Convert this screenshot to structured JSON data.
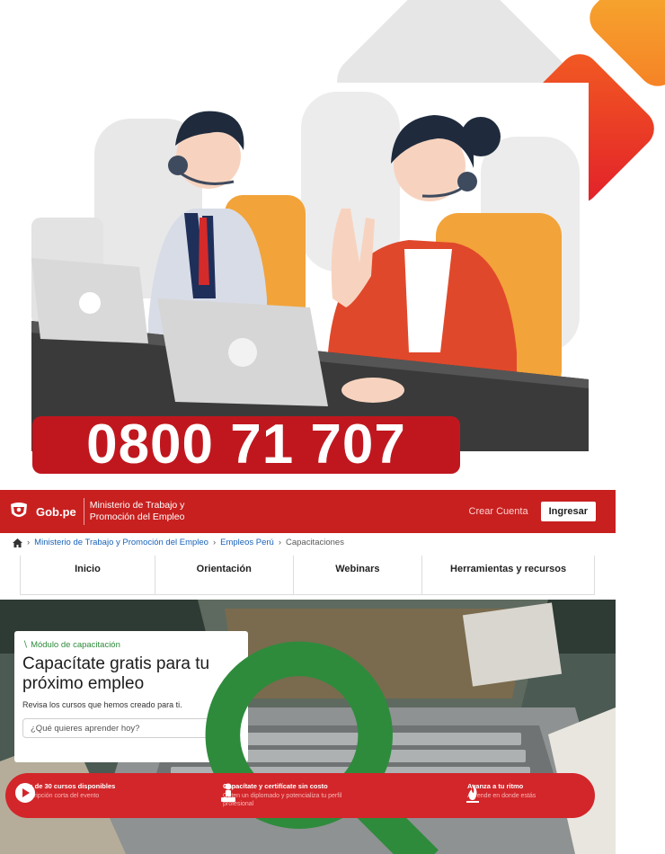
{
  "promo": {
    "phone_number": "0800 71 707"
  },
  "site": {
    "header": {
      "logo_text": "Gob.pe",
      "ministry_name": "Ministerio de Trabajo y Promoción del Empleo",
      "create_account": "Crear Cuenta",
      "login": "Ingresar"
    },
    "breadcrumb": [
      "Ministerio de Trabajo y Promoción del Empleo",
      "Empleos Perú",
      "Capacitaciones"
    ],
    "nav": {
      "items": [
        {
          "label": "Inicio"
        },
        {
          "label": "Orientación"
        },
        {
          "label": "Webinars"
        },
        {
          "label": "Herramientas y recursos"
        }
      ]
    },
    "hero": {
      "module_label": "Módulo de capacitación",
      "title": "Capacítate gratis para tu próximo empleo",
      "subtitle": "Revisa los cursos que hemos creado para ti.",
      "search_placeholder": "¿Qué quieres aprender hoy?"
    },
    "features": [
      {
        "title": "Más de 30 cursos disponibles",
        "desc": "Descripción corta del evento",
        "icon": "play-circle-icon"
      },
      {
        "title": "Capacítate y certifícate sin costo",
        "desc": "Opten un diplomado y potencializa tu perfil profesional",
        "icon": "person-podium-icon"
      },
      {
        "title": "Avanza a tu ritmo",
        "desc": "Aprende en donde estás",
        "icon": "flame-icon"
      }
    ],
    "colors": {
      "brand_red": "#c7201f",
      "banner_red": "#d2262a",
      "link_blue": "#1a63b8",
      "accent_green": "#2e8b3c"
    }
  }
}
